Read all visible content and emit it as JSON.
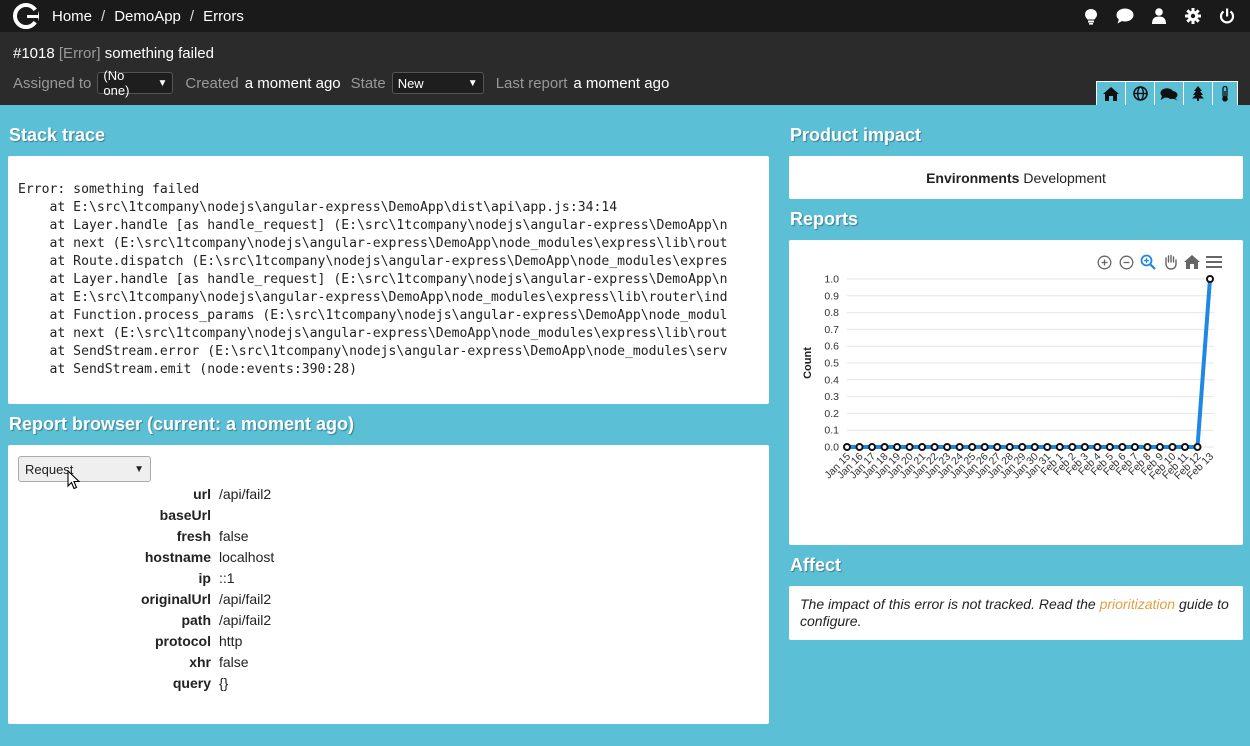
{
  "nav": {
    "logo": "logo",
    "breadcrumbs": [
      "Home",
      "DemoApp",
      "Errors"
    ],
    "separator": "/",
    "icons": [
      "lightbulb-icon",
      "chat-icon",
      "user-icon",
      "gear-icon",
      "power-icon"
    ]
  },
  "header": {
    "id": "#1018",
    "type": "[Error]",
    "message": "something failed",
    "assigned_label": "Assigned to",
    "assigned_value": "(No one)",
    "created_label": "Created",
    "created_value": "a moment ago",
    "state_label": "State",
    "state_value": "New",
    "last_report_label": "Last report",
    "last_report_value": "a moment ago",
    "tabs": [
      "home-icon",
      "globe-icon",
      "comments-icon",
      "tree-icon",
      "thermometer-icon"
    ]
  },
  "stack": {
    "title": "Stack trace",
    "lines": [
      "Error: something failed",
      "    at E:\\src\\1tcompany\\nodejs\\angular-express\\DemoApp\\dist\\api\\app.js:34:14",
      "    at Layer.handle [as handle_request] (E:\\src\\1tcompany\\nodejs\\angular-express\\DemoApp\\n",
      "    at next (E:\\src\\1tcompany\\nodejs\\angular-express\\DemoApp\\node_modules\\express\\lib\\rout",
      "    at Route.dispatch (E:\\src\\1tcompany\\nodejs\\angular-express\\DemoApp\\node_modules\\expres",
      "    at Layer.handle [as handle_request] (E:\\src\\1tcompany\\nodejs\\angular-express\\DemoApp\\n",
      "    at E:\\src\\1tcompany\\nodejs\\angular-express\\DemoApp\\node_modules\\express\\lib\\router\\ind",
      "    at Function.process_params (E:\\src\\1tcompany\\nodejs\\angular-express\\DemoApp\\node_modul",
      "    at next (E:\\src\\1tcompany\\nodejs\\angular-express\\DemoApp\\node_modules\\express\\lib\\rout",
      "    at SendStream.error (E:\\src\\1tcompany\\nodejs\\angular-express\\DemoApp\\node_modules\\serv",
      "    at SendStream.emit (node:events:390:28)"
    ]
  },
  "browser": {
    "title": "Report browser (current: a moment ago)",
    "select_value": "Request",
    "rows": [
      {
        "key": "url",
        "value": "/api/fail2"
      },
      {
        "key": "baseUrl",
        "value": ""
      },
      {
        "key": "fresh",
        "value": "false"
      },
      {
        "key": "hostname",
        "value": "localhost"
      },
      {
        "key": "ip",
        "value": "::1"
      },
      {
        "key": "originalUrl",
        "value": "/api/fail2"
      },
      {
        "key": "path",
        "value": "/api/fail2"
      },
      {
        "key": "protocol",
        "value": "http"
      },
      {
        "key": "xhr",
        "value": "false"
      },
      {
        "key": "query",
        "value": "{}"
      }
    ]
  },
  "impact": {
    "title": "Product impact",
    "env_label": "Environments",
    "env_value": "Development"
  },
  "reports": {
    "title": "Reports",
    "toolbar": [
      "zoom-in-icon",
      "zoom-out-icon",
      "zoom-select-icon",
      "pan-icon",
      "reset-home-icon",
      "menu-icon"
    ]
  },
  "affect": {
    "title": "Affect",
    "text_before": "The impact of this error is not tracked. Read the ",
    "link": "prioritization",
    "text_after": " guide to configure."
  },
  "colors": {
    "accent": "#5bc0d6",
    "navbar": "#1a1a1a",
    "header": "#2b2b2b",
    "series": "#1e88e5",
    "link": "#e0a040"
  },
  "chart_data": {
    "type": "line",
    "ylabel": "Count",
    "ylim": [
      0,
      1
    ],
    "yticks": [
      0.0,
      0.1,
      0.2,
      0.3,
      0.4,
      0.5,
      0.6,
      0.7,
      0.8,
      0.9,
      1.0
    ],
    "grid": true,
    "categories": [
      "Jan 15",
      "Jan 16",
      "Jan 17",
      "Jan 18",
      "Jan 19",
      "Jan 20",
      "Jan 21",
      "Jan 22",
      "Jan 23",
      "Jan 24",
      "Jan 25",
      "Jan 26",
      "Jan 27",
      "Jan 28",
      "Jan 29",
      "Jan 30",
      "Jan 31",
      "Feb 1",
      "Feb 2",
      "Feb 3",
      "Feb 4",
      "Feb 5",
      "Feb 6",
      "Feb 7",
      "Feb 8",
      "Feb 9",
      "Feb 10",
      "Feb 11",
      "Feb 12",
      "Feb 13"
    ],
    "series": [
      {
        "values": [
          0,
          0,
          0,
          0,
          0,
          0,
          0,
          0,
          0,
          0,
          0,
          0,
          0,
          0,
          0,
          0,
          0,
          0,
          0,
          0,
          0,
          0,
          0,
          0,
          0,
          0,
          0,
          0,
          0,
          1
        ]
      }
    ]
  }
}
